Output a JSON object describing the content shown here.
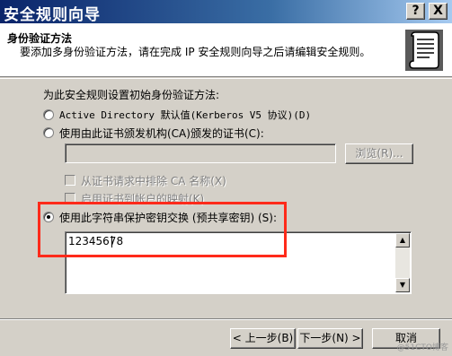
{
  "window": {
    "title": "安全规则向导",
    "help_button": "?",
    "close_button": "X"
  },
  "header": {
    "title": "身份验证方法",
    "description": "要添加多身份验证方法，请在完成 IP 安全规则向导之后请编辑安全规则。",
    "icon": "scroll-document-icon"
  },
  "main": {
    "instruction": "为此安全规则设置初始身份验证方法:",
    "options": {
      "active_directory": "Active Directory 默认值(Kerberos V5 协议)(D)",
      "certificate": "使用由此证书颁发机构(CA)颁发的证书(C):",
      "preshared_key": "使用此字符串保护密钥交换 (预共享密钥) (S):"
    },
    "selected_option": "preshared_key",
    "certificate_value": "",
    "browse_button": "浏览(R)...",
    "exclude_ca_checkbox": "从证书请求中排除 CA 名称(X)",
    "map_account_checkbox": "启用证书到帐户的映射(K)",
    "preshared_key_value": "12345678"
  },
  "footer": {
    "back_button": "< 上一步(B)",
    "next_button": "下一步(N) >",
    "cancel_button": "取消",
    "watermark": "@51CTO博客"
  }
}
